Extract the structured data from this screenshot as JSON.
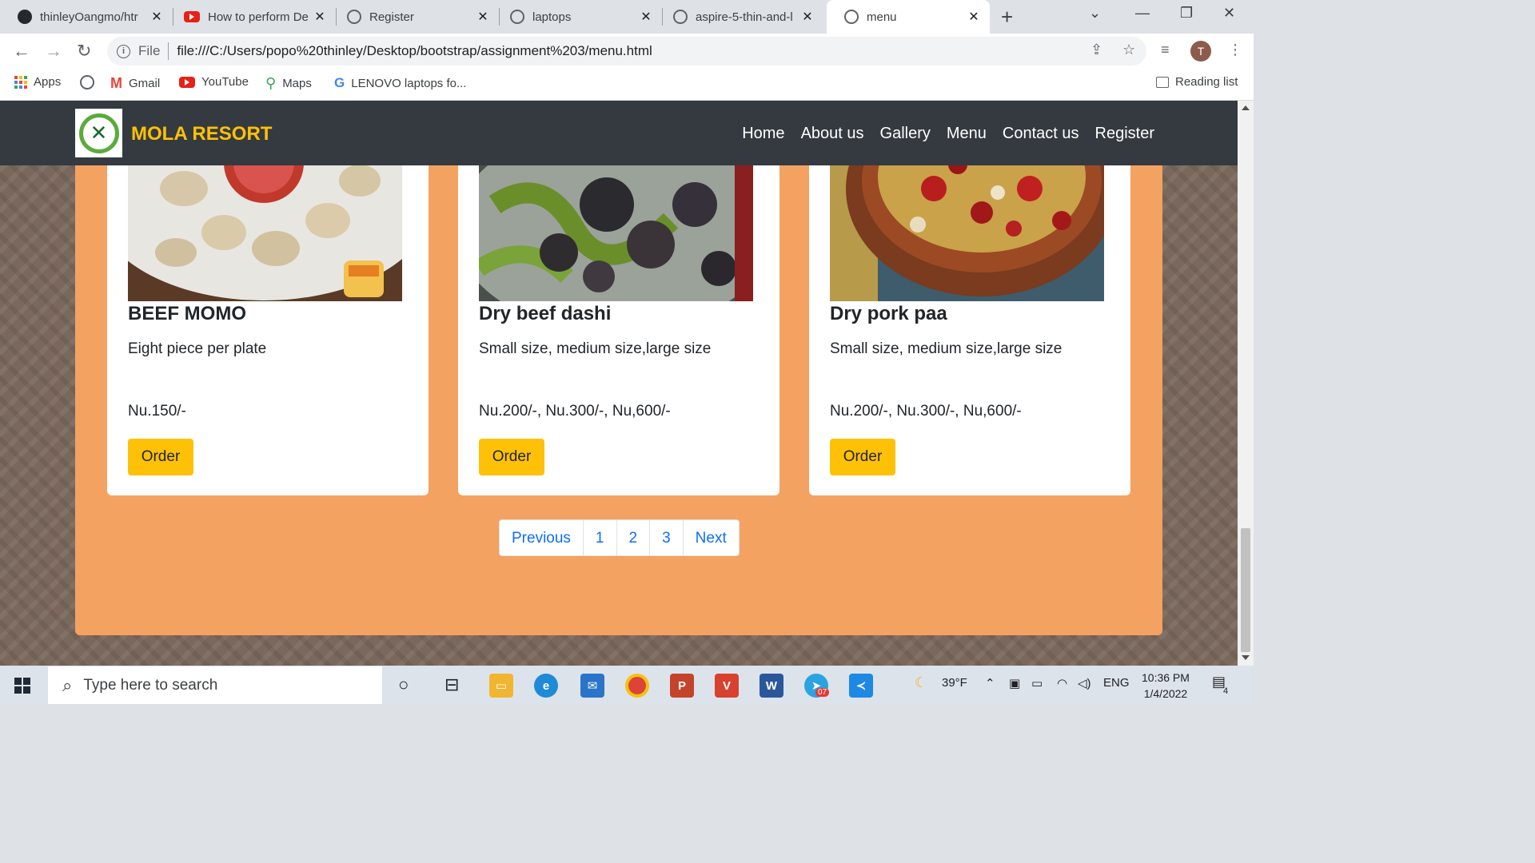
{
  "browser": {
    "tabs": [
      {
        "title": "thinleyOangmo/htr",
        "favicon": "github-icon"
      },
      {
        "title": "How to perform De",
        "favicon": "youtube-icon"
      },
      {
        "title": "Register",
        "favicon": "globe-icon"
      },
      {
        "title": "laptops",
        "favicon": "globe-icon"
      },
      {
        "title": "aspire-5-thin-and-l",
        "favicon": "globe-icon"
      },
      {
        "title": "menu",
        "favicon": "globe-icon",
        "active": true
      }
    ],
    "address": {
      "scheme_label": "File",
      "url": "file:///C:/Users/popo%20thinley/Desktop/bootstrap/assignment%203/menu.html"
    },
    "profile_initial": "T",
    "bookmarks": [
      {
        "label": "Apps"
      },
      {
        "label": ""
      },
      {
        "label": "Gmail"
      },
      {
        "label": "YouTube"
      },
      {
        "label": "Maps"
      },
      {
        "label": "LENOVO laptops fo..."
      }
    ],
    "reading_list_label": "Reading list"
  },
  "site": {
    "brand": "MOLA RESORT",
    "brand_color": "#ffc107",
    "nav": [
      "Home",
      "About us",
      "Gallery",
      "Menu",
      "Contact us",
      "Register"
    ],
    "cards": [
      {
        "title": "BEEF MOMO",
        "desc": "Eight piece per plate",
        "price": "Nu.150/-",
        "button": "Order"
      },
      {
        "title": "Dry beef dashi",
        "desc": "Small size, medium size,large size",
        "price": "Nu.200/-, Nu.300/-, Nu,600/-",
        "button": "Order"
      },
      {
        "title": "Dry pork paa",
        "desc": "Small size, medium size,large size",
        "price": "Nu.200/-, Nu.300/-, Nu,600/-",
        "button": "Order"
      }
    ],
    "pagination": [
      "Previous",
      "1",
      "2",
      "3",
      "Next"
    ],
    "panel_color": "#f4a261"
  },
  "taskbar": {
    "search_placeholder": "Type here to search",
    "weather": "39°F",
    "language": "ENG",
    "time": "10:36 PM",
    "date": "1/4/2022",
    "notifications": "4",
    "telegram_badge": "07"
  }
}
